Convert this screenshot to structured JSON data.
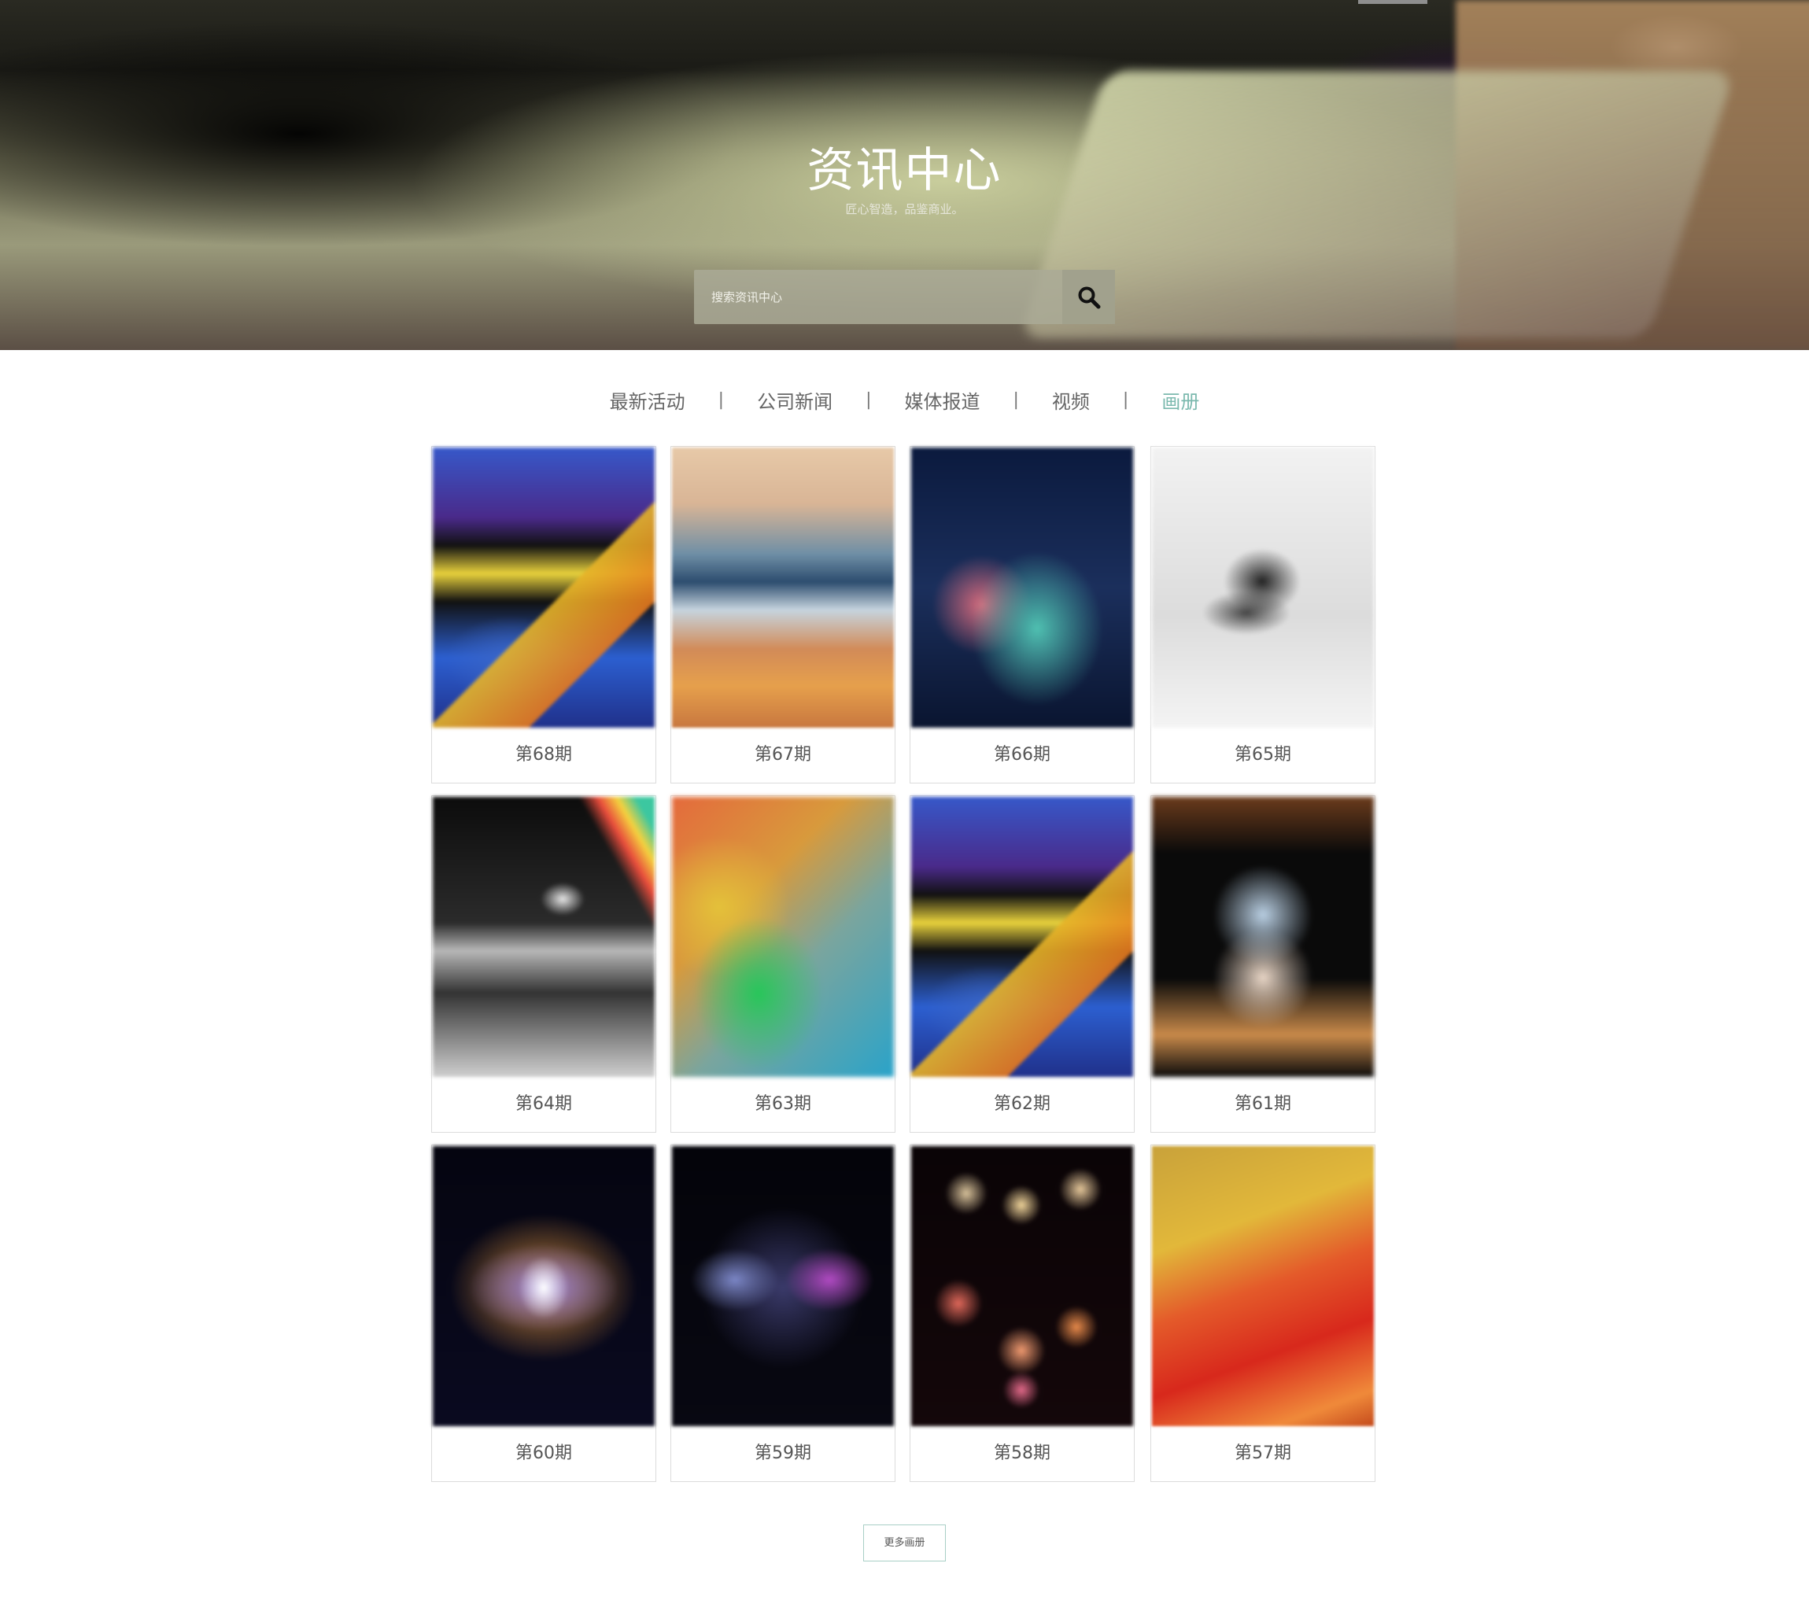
{
  "hero": {
    "title": "资讯中心",
    "subtitle": "匠心智造，品鉴商业。",
    "search_placeholder": "搜索资讯中心",
    "search_icon": "search-icon"
  },
  "tabs": [
    {
      "label": "最新活动",
      "active": false
    },
    {
      "label": "公司新闻",
      "active": false
    },
    {
      "label": "媒体报道",
      "active": false
    },
    {
      "label": "视频",
      "active": false
    },
    {
      "label": "画册",
      "active": true
    }
  ],
  "tab_separator": "|",
  "accent_color": "#7bb9ae",
  "albums": [
    {
      "title": "第68期"
    },
    {
      "title": "第67期"
    },
    {
      "title": "第66期"
    },
    {
      "title": "第65期"
    },
    {
      "title": "第64期"
    },
    {
      "title": "第63期"
    },
    {
      "title": "第62期"
    },
    {
      "title": "第61期"
    },
    {
      "title": "第60期"
    },
    {
      "title": "第59期"
    },
    {
      "title": "第58期"
    },
    {
      "title": "第57期"
    }
  ],
  "more_button": "更多画册"
}
